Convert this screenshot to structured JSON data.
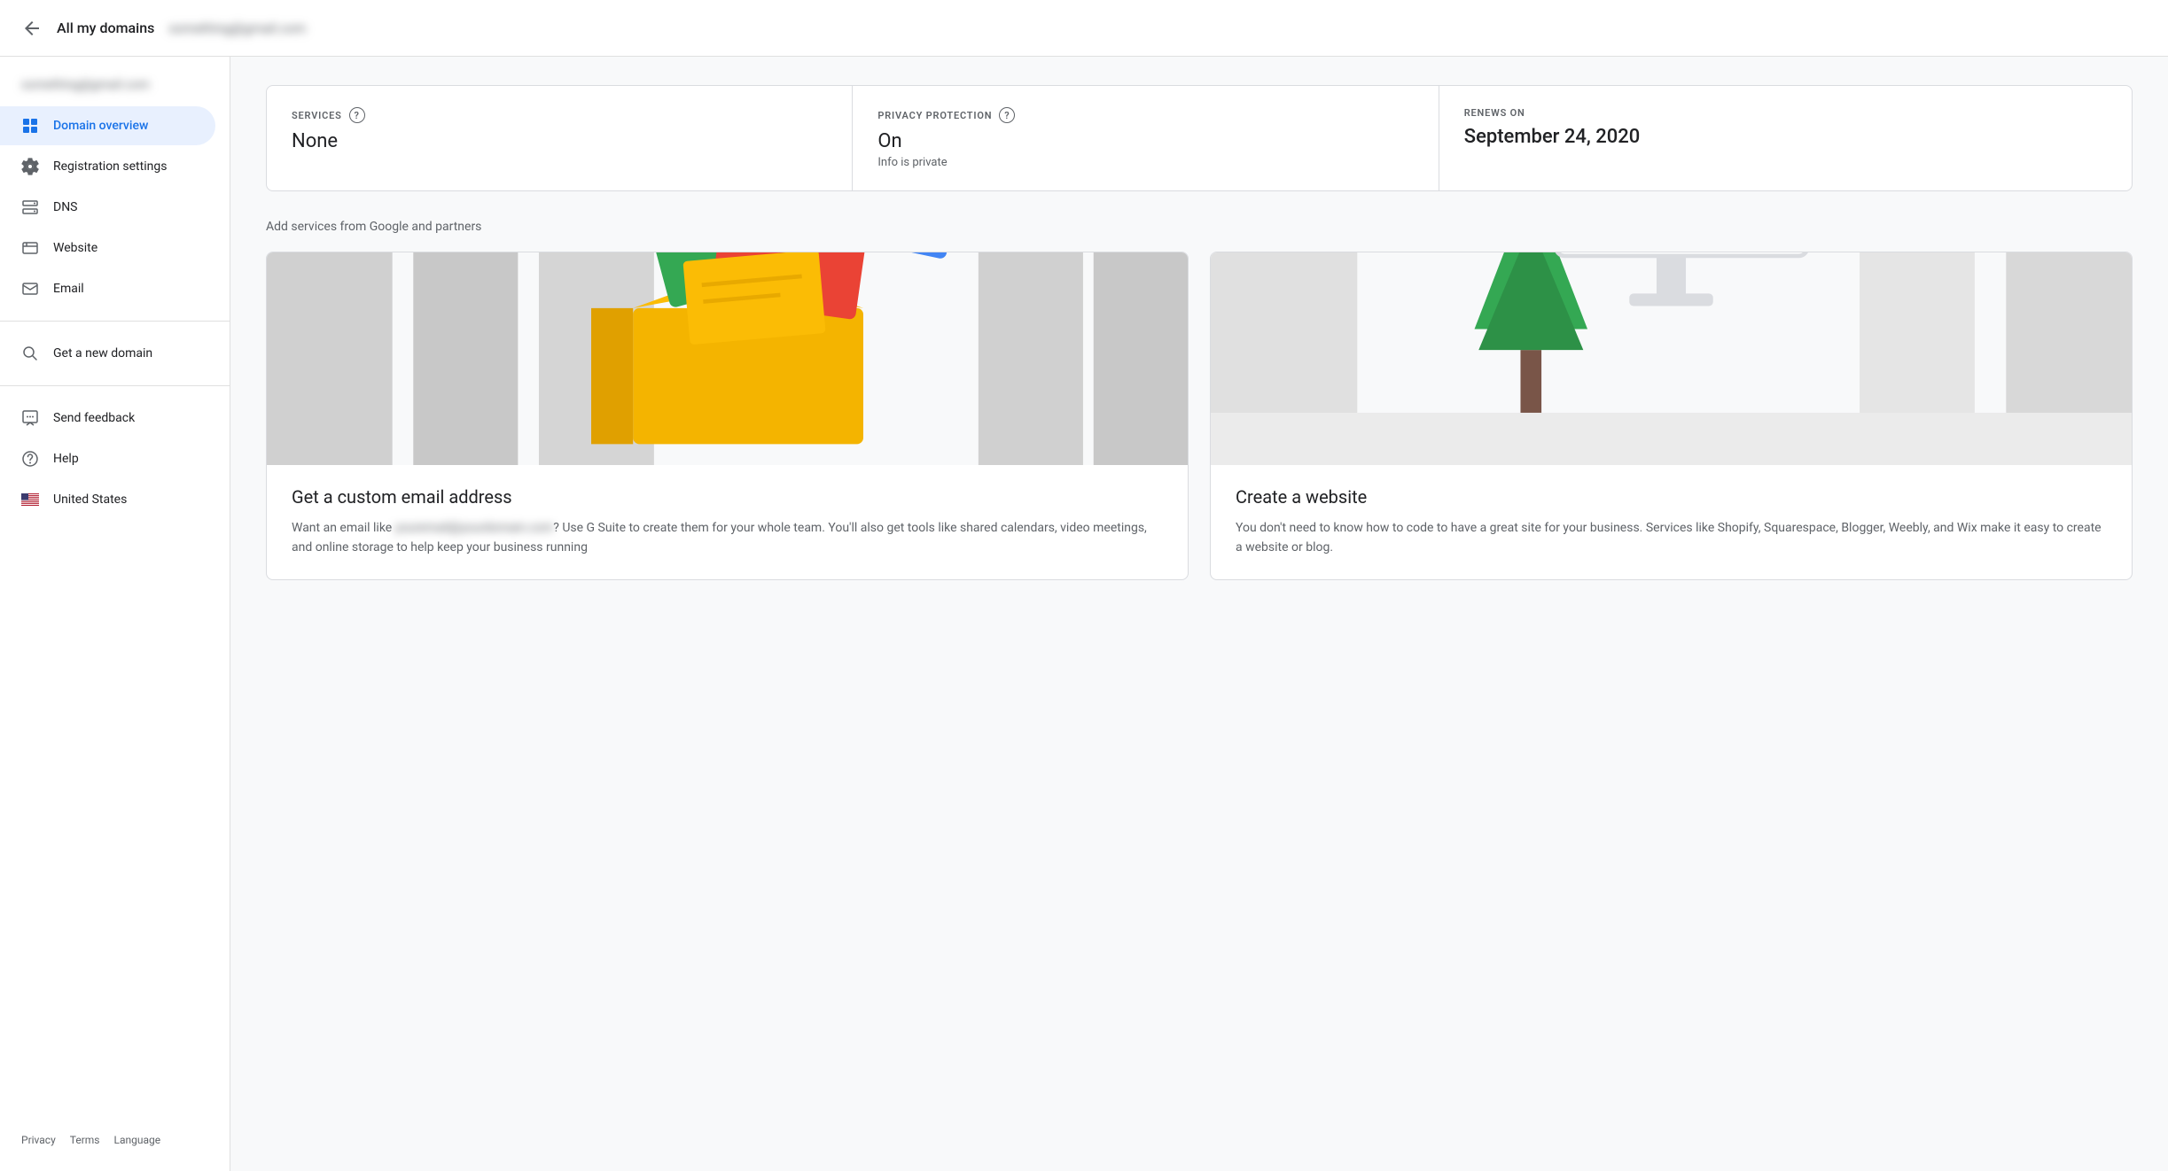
{
  "topbar": {
    "back_label": "All my domains",
    "domain": "something@gmail.com"
  },
  "sidebar": {
    "domain": "something@gmail.com",
    "nav_items": [
      {
        "id": "domain-overview",
        "label": "Domain overview",
        "icon": "grid-icon",
        "active": true
      },
      {
        "id": "registration-settings",
        "label": "Registration settings",
        "icon": "gear-icon",
        "active": false
      },
      {
        "id": "dns",
        "label": "DNS",
        "icon": "dns-icon",
        "active": false
      },
      {
        "id": "website",
        "label": "Website",
        "icon": "website-icon",
        "active": false
      },
      {
        "id": "email",
        "label": "Email",
        "icon": "email-icon",
        "active": false
      }
    ],
    "extra_items": [
      {
        "id": "get-new-domain",
        "label": "Get a new domain",
        "icon": "search-icon"
      },
      {
        "id": "send-feedback",
        "label": "Send feedback",
        "icon": "feedback-icon"
      },
      {
        "id": "help",
        "label": "Help",
        "icon": "help-icon"
      },
      {
        "id": "united-states",
        "label": "United States",
        "icon": "flag-icon"
      }
    ],
    "footer_links": [
      "Privacy",
      "Terms",
      "Language"
    ]
  },
  "info_card": {
    "services": {
      "label": "SERVICES",
      "value": "None"
    },
    "privacy": {
      "label": "PRIVACY PROTECTION",
      "value": "On",
      "sub": "Info is private"
    },
    "renews": {
      "label": "RENEWS ON",
      "value": "September 24, 2020"
    }
  },
  "services_section": {
    "heading": "Add services from Google and partners",
    "cards": [
      {
        "id": "email-card",
        "title": "Get a custom email address",
        "description": "Want an email like you@yourdomain.com? Use G Suite to create them for your whole team. You'll also get tools like shared calendars, video meetings, and online storage to help keep your business running"
      },
      {
        "id": "website-card",
        "title": "Create a website",
        "description": "You don't need to know how to code to have a great site for your business. Services like Shopify, Squarespace, Blogger, Weebly, and Wix make it easy to create a website or blog."
      }
    ]
  }
}
